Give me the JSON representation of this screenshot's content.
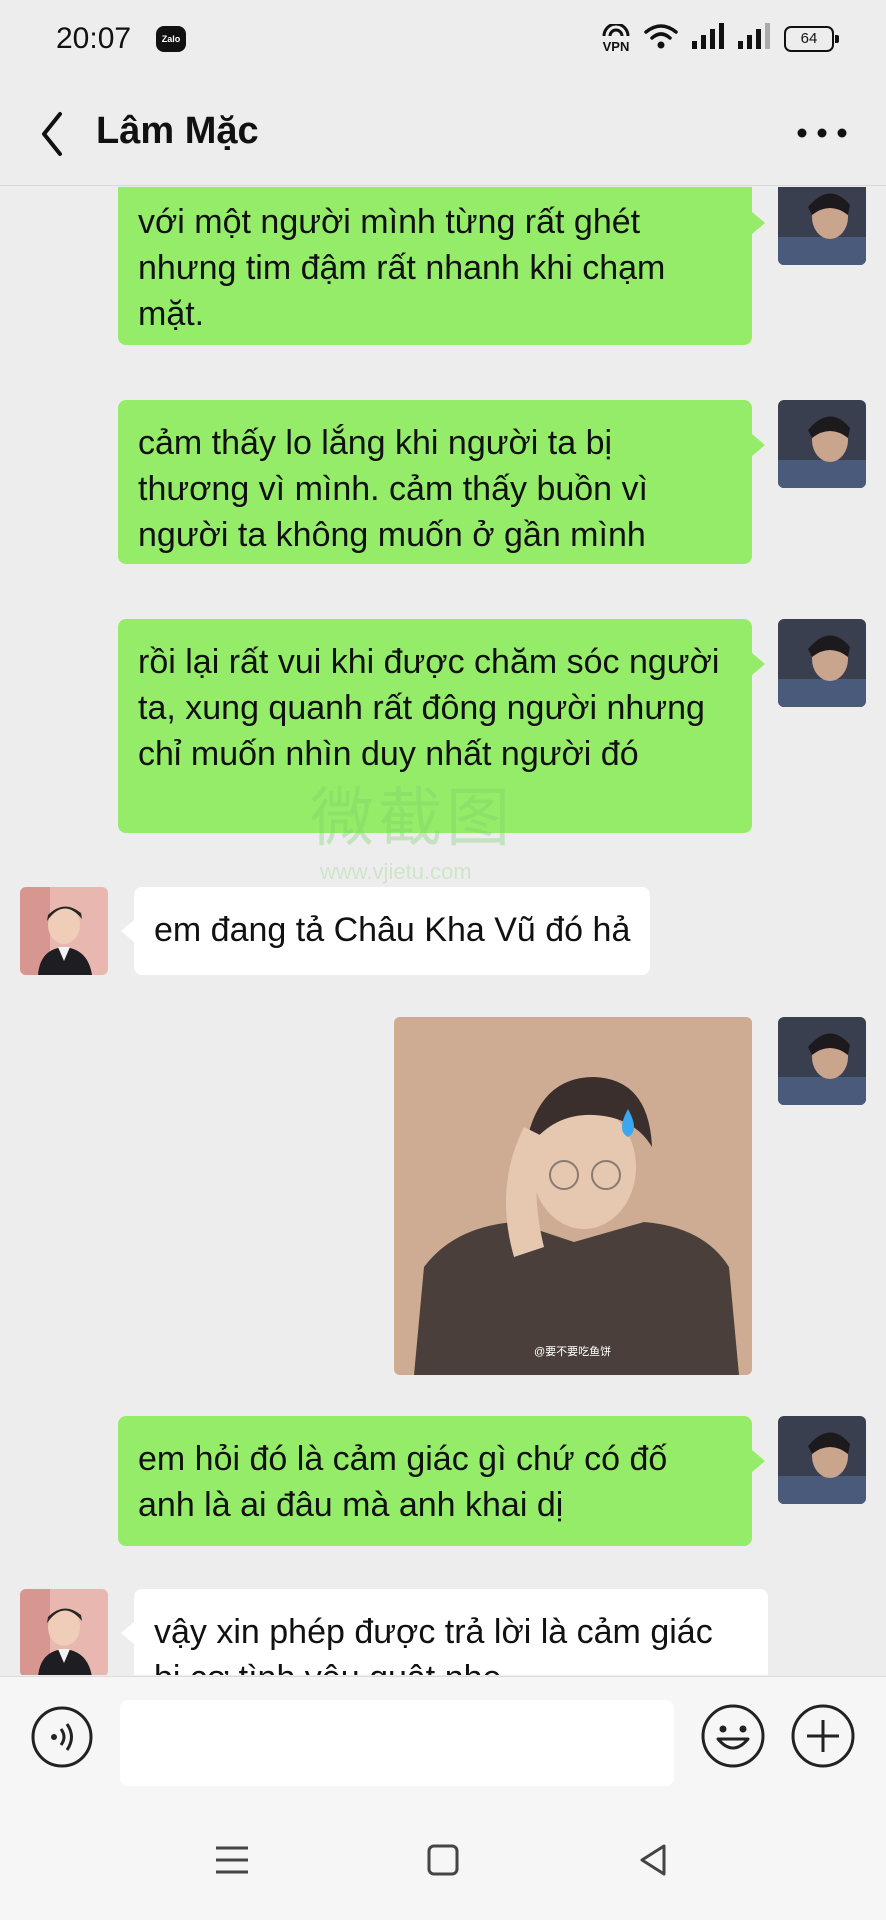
{
  "status_bar": {
    "time": "20:07",
    "zalo_badge": "Zalo",
    "vpn": "VPN",
    "battery": "64"
  },
  "header": {
    "contact_name": "Lâm Mặc"
  },
  "messages": [
    {
      "side": "me",
      "text": "với một người mình từng rất ghét nhưng tim đậm rất nhanh khi chạm mặt."
    },
    {
      "side": "me",
      "text": "cảm thấy lo lắng khi người ta bị thương vì mình. cảm thấy buồn vì người ta không muốn ở gần mình"
    },
    {
      "side": "me",
      "text": "rồi lại rất vui khi được chăm sóc người ta, xung quanh rất đông người nhưng chỉ muốn nhìn duy nhất người đó"
    },
    {
      "side": "them",
      "text": "em đang tả Châu Kha Vũ đó hả"
    },
    {
      "side": "me",
      "type": "sticker",
      "caption": "@要不要吃鱼饼"
    },
    {
      "side": "me",
      "text": "em hỏi đó là cảm giác gì chứ có đố anh là ai đâu mà anh khai dị"
    },
    {
      "side": "them",
      "text": "vậy xin phép được trả lời là cảm giác bị cơ tình yêu quật nhe"
    }
  ],
  "watermark": {
    "text": "微截图",
    "url": "www.vjietu.com"
  },
  "colors": {
    "my_bubble": "#95ec69",
    "their_bubble": "#ffffff",
    "background": "#ededed"
  }
}
